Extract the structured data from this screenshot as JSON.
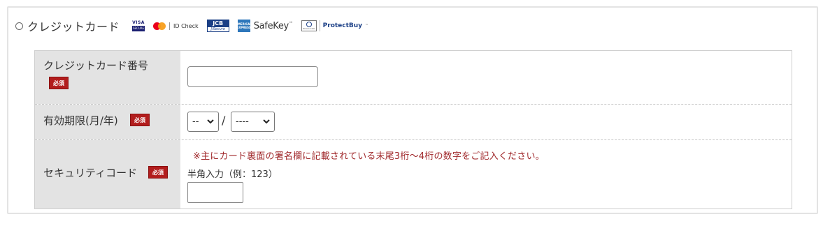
{
  "payment_method": {
    "label": "クレジットカード",
    "selected": false
  },
  "brand_logos": {
    "visa": "VISA",
    "visa_sub": "SECURE",
    "mastercard": "ID Check",
    "jcb": "JCB",
    "jcb_sub": "J/Secure",
    "amex": "AMERICAN EXPRESS",
    "safekey": "SafeKey",
    "safekey_tm": "™",
    "diners_sub": "Diners Club",
    "protectbuy": "ProtectBuy",
    "protectbuy_tm": "™"
  },
  "form": {
    "required_badge": "必須",
    "card_number": {
      "label": "クレジットカード番号",
      "value": "",
      "placeholder": ""
    },
    "expiry": {
      "label": "有効期限(月/年)",
      "month_value": "--",
      "separator": "/",
      "year_value": "----"
    },
    "security_code": {
      "label": "セキュリティコード",
      "note": "※主にカード裏面の署名欄に記載されている末尾3桁～4桁の数字をご記入ください。",
      "hint": "半角入力（例：123）",
      "value": ""
    }
  },
  "colors": {
    "required_badge_bg": "#b21d1d",
    "note_text": "#a0282b",
    "label_cell_bg": "#e3e3e3"
  }
}
